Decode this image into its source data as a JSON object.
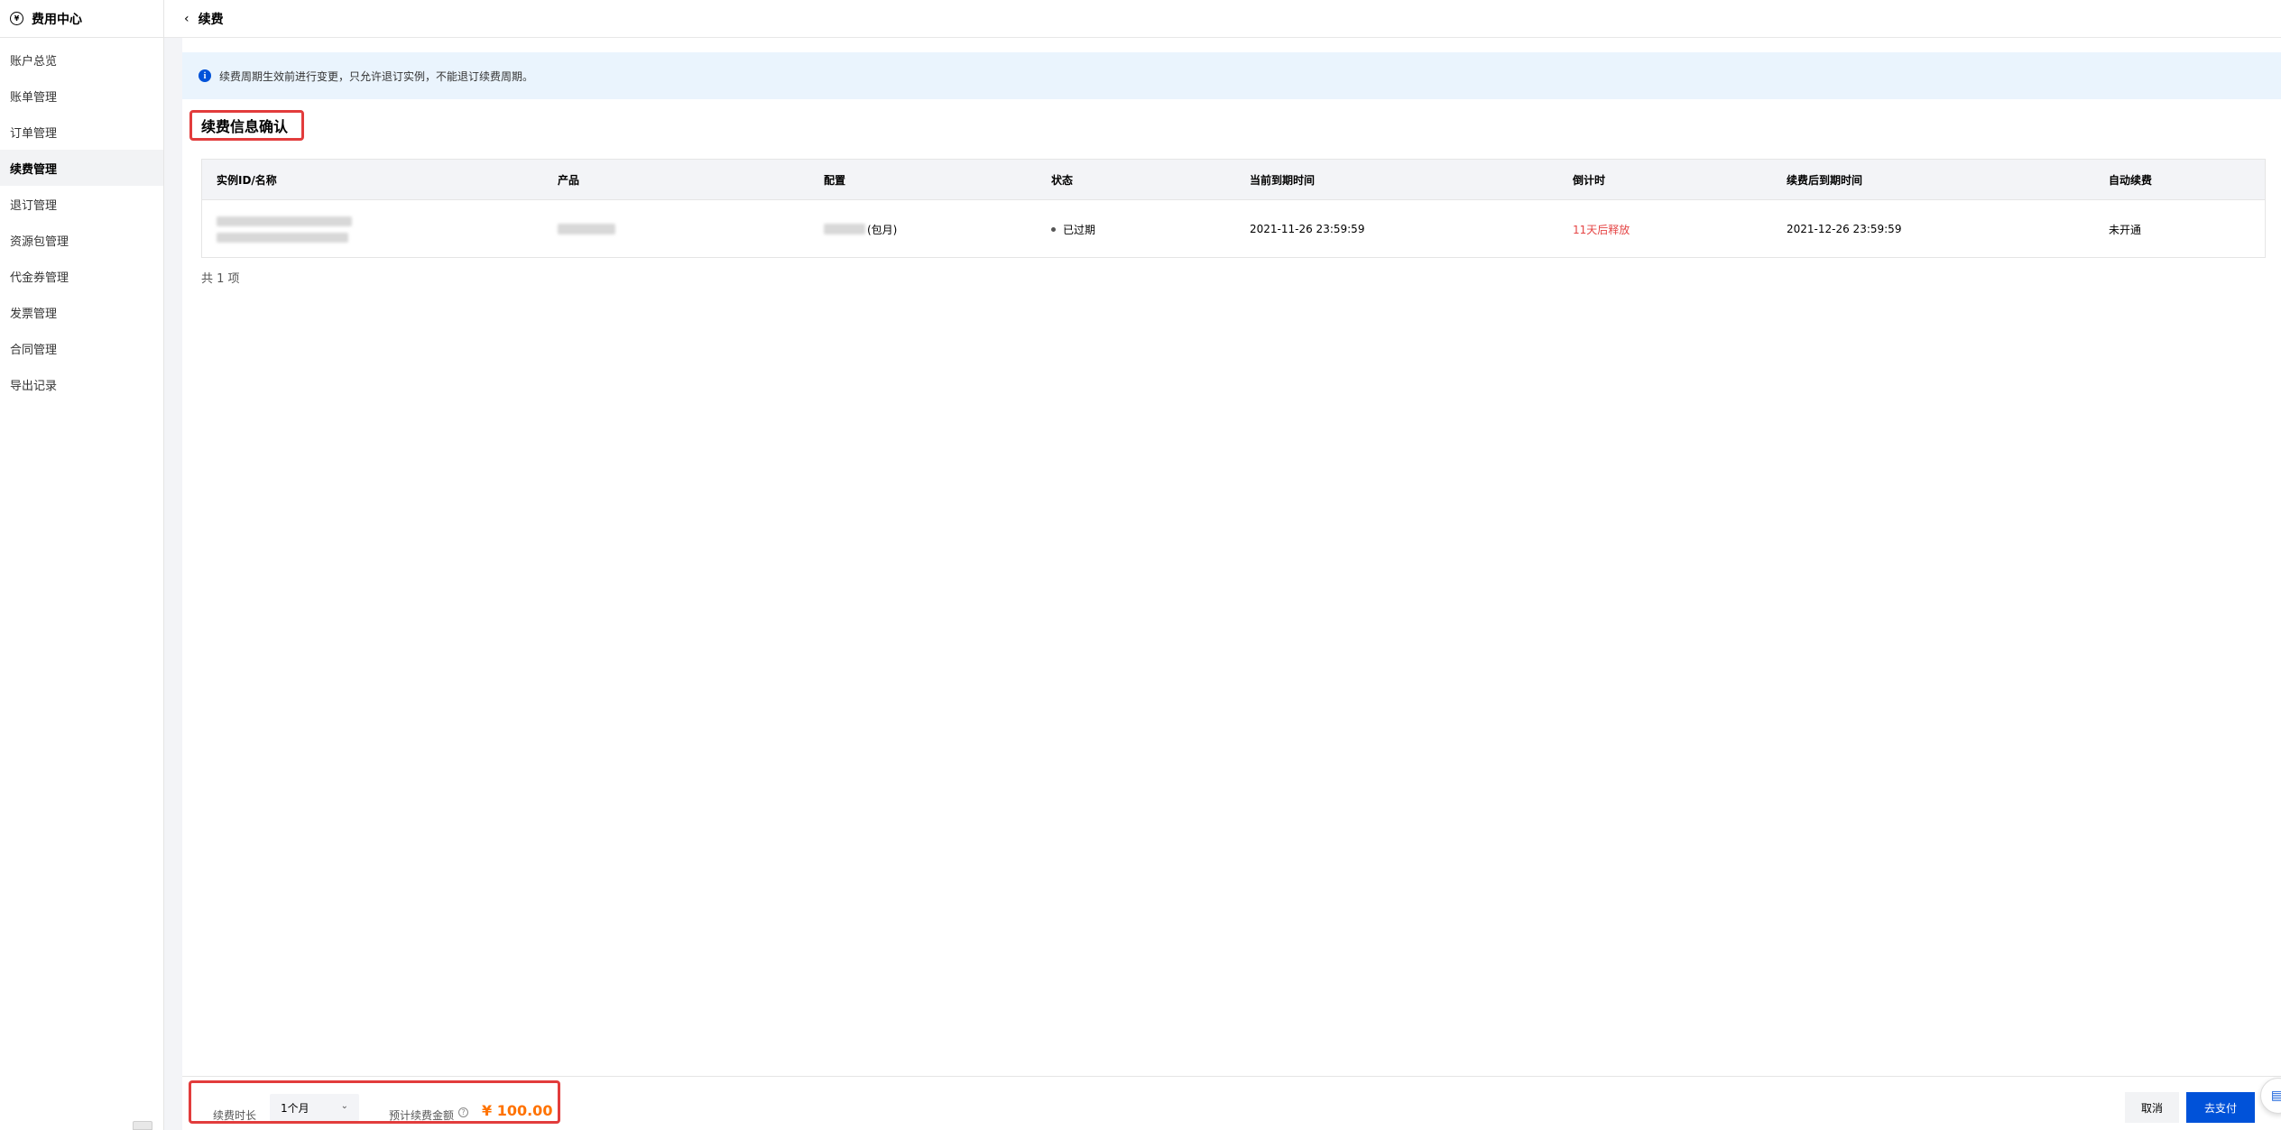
{
  "sidebar": {
    "title": "费用中心",
    "brand_icon": "¥",
    "items": [
      {
        "label": "账户总览",
        "active": false
      },
      {
        "label": "账单管理",
        "active": false
      },
      {
        "label": "订单管理",
        "active": false
      },
      {
        "label": "续费管理",
        "active": true
      },
      {
        "label": "退订管理",
        "active": false
      },
      {
        "label": "资源包管理",
        "active": false
      },
      {
        "label": "代金券管理",
        "active": false
      },
      {
        "label": "发票管理",
        "active": false
      },
      {
        "label": "合同管理",
        "active": false
      },
      {
        "label": "导出记录",
        "active": false
      }
    ]
  },
  "header": {
    "back_icon": "‹",
    "title": "续费"
  },
  "banner": {
    "icon": "i",
    "text": "续费周期生效前进行变更，只允许退订实例，不能退订续费周期。"
  },
  "section": {
    "title": "续费信息确认"
  },
  "table": {
    "columns": [
      "实例ID/名称",
      "产品",
      "配置",
      "状态",
      "当前到期时间",
      "倒计时",
      "续费后到期时间",
      "自动续费"
    ],
    "rows": [
      {
        "config_suffix": "(包月)",
        "status": "已过期",
        "current_expiry": "2021-11-26 23:59:59",
        "countdown": "11天后释放",
        "renewed_expiry": "2021-12-26 23:59:59",
        "auto_renew": "未开通"
      }
    ],
    "total": "共 1 项"
  },
  "footer": {
    "duration_label": "续费时长",
    "duration_value": "1个月",
    "chevron": "⌄",
    "estimate_label": "预计续费金额",
    "help_icon": "?",
    "estimate_amount": "¥ 100.00",
    "cancel_label": "取消",
    "pay_label": "去支付"
  },
  "colors": {
    "accent": "#0052d9",
    "price": "#ff7200",
    "countdown": "#e54545",
    "highlight_box": "#e23c3c"
  }
}
